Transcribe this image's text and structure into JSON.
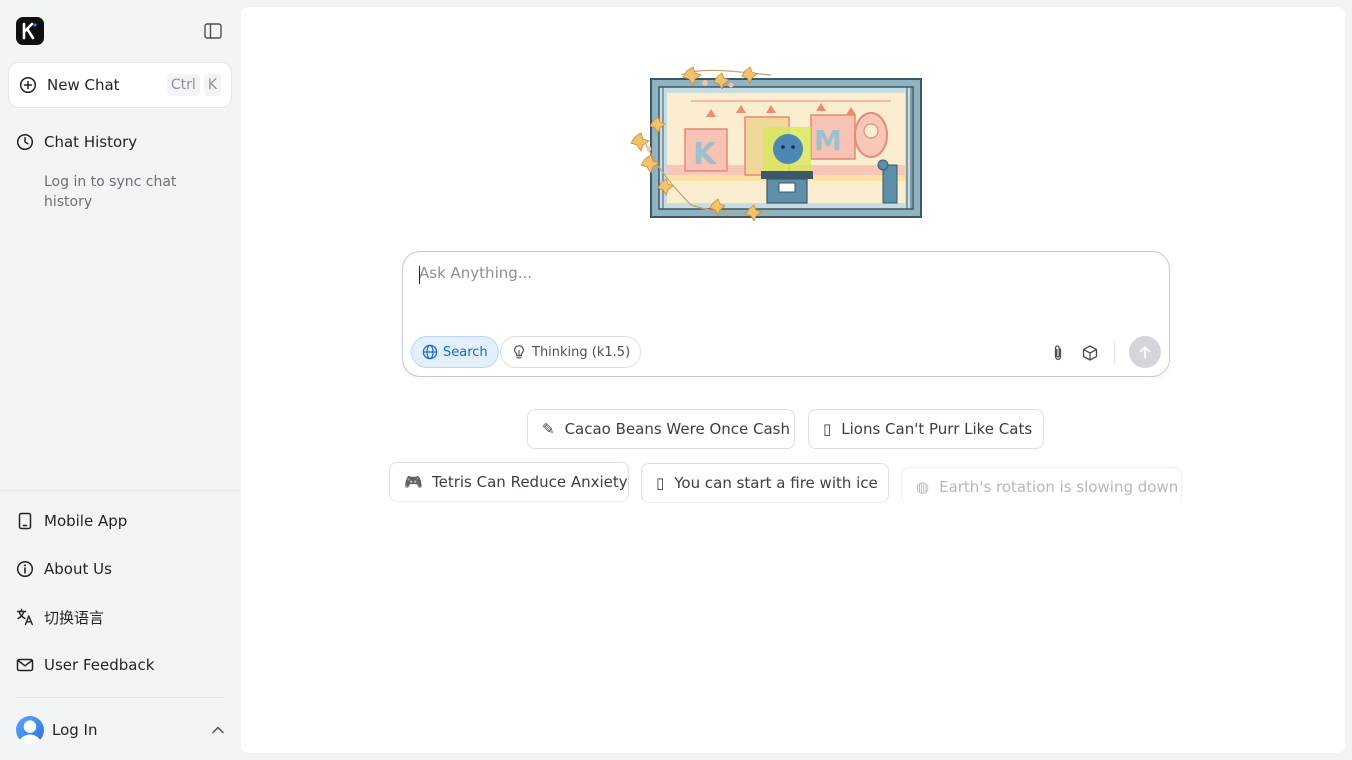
{
  "sidebar": {
    "logo_letter": "K",
    "new_chat_label": "New Chat",
    "new_chat_shortcut": [
      "Ctrl",
      "K"
    ],
    "chat_history_label": "Chat History",
    "sync_note": "Log in to sync chat history",
    "bottom_items": [
      {
        "label": "Mobile App",
        "icon": "phone-icon"
      },
      {
        "label": "About Us",
        "icon": "info-icon"
      },
      {
        "label": "切换语言",
        "icon": "language-icon"
      },
      {
        "label": "User Feedback",
        "icon": "mail-icon"
      }
    ],
    "login_label": "Log In"
  },
  "main": {
    "input_placeholder": "Ask Anything...",
    "chips": {
      "search": "Search",
      "thinking": "Thinking (k1.5)"
    },
    "suggestions": [
      {
        "label": "Cacao Beans Were Once Cash",
        "icon": "cacao-icon"
      },
      {
        "label": "Lions Can't Purr Like Cats",
        "icon": "lion-icon"
      },
      {
        "label": "Tetris Can Reduce Anxiety",
        "icon": "gamepad-icon"
      },
      {
        "label": "You can start a fire with ice",
        "icon": "ice-icon"
      },
      {
        "label": "Earth's rotation is slowing down",
        "icon": "globe-icon"
      }
    ]
  },
  "colors": {
    "accent": "#1769c2",
    "accent_bg": "#e3f0fc",
    "sidebar_bg": "#f3f4f6"
  }
}
